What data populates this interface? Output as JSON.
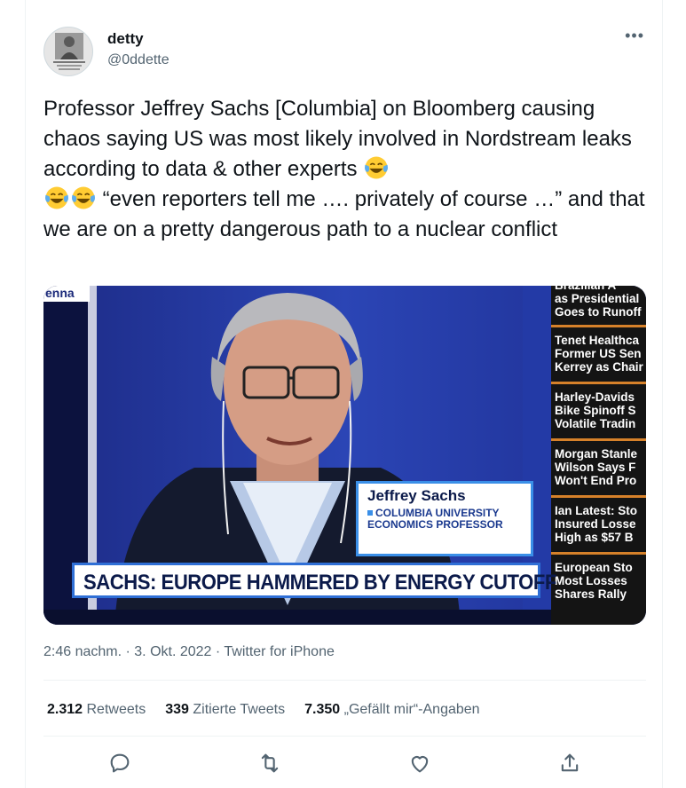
{
  "user": {
    "display_name": "detty",
    "handle": "@0ddette",
    "more_label": "•••"
  },
  "tweet": {
    "line1": "Professor Jeffrey Sachs [Columbia] on Bloomberg causing chaos saying US was most likely involved in Nordstream leaks according to data & other experts ",
    "line2": " “even reporters tell me …. privately of course …” and that we are on a pretty dangerous path to a nuclear conflict"
  },
  "media": {
    "corner_tag": "enna",
    "ticker": [
      "Brazilian A\nas Presidential\nGoes to Runoff",
      "Tenet Healthca\nFormer US Sen\nKerrey as Chair",
      "Harley-Davids\nBike Spinoff S\nVolatile Tradin",
      "Morgan Stanle\nWilson Says F\nWon't End Pro",
      "Ian Latest: Sto\nInsured Losse\nHigh as $57 B",
      "European Sto\nMost Losses\nShares Rally"
    ],
    "lower_third_name": "Jeffrey Sachs",
    "lower_third_title": "COLUMBIA UNIVERSITY\nECONOMICS PROFESSOR",
    "banner": "SACHS: EUROPE HAMMERED BY ENERGY CUTOFF"
  },
  "meta": {
    "timestamp": "2:46 nachm. · 3. Okt. 2022 · Twitter for iPhone"
  },
  "stats": {
    "retweets_count": "2.312",
    "retweets_label": "Retweets",
    "quotes_count": "339",
    "quotes_label": "Zitierte Tweets",
    "likes_count": "7.350",
    "likes_label": "„Gefällt mir“-Angaben"
  },
  "icons": {
    "reply": "reply-icon",
    "retweet": "retweet-icon",
    "like": "heart-icon",
    "share": "share-icon",
    "emoji": "tears-of-joy-emoji"
  },
  "colors": {
    "text": "#0f1419",
    "secondary": "#536471",
    "border": "#eff3f4",
    "emoji_face": "#ffcc33",
    "ticker_accent": "#d6812a",
    "banner_border": "#2f6fd6"
  }
}
